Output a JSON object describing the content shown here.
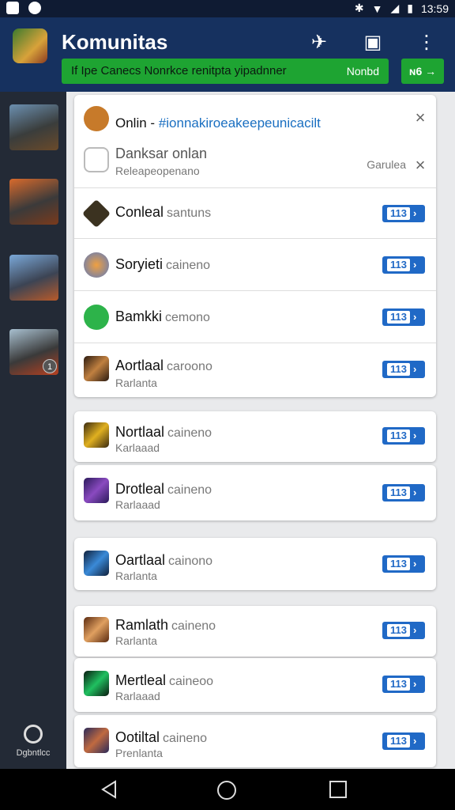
{
  "status_bar": {
    "time": "13:59"
  },
  "app_bar": {
    "title": "Komunitas",
    "banner_text": "If Ipe Canecs Nonrkce renitpta yipadnner",
    "banner_right": "Nonbd",
    "banner_button": "ɴ6 →",
    "actions": [
      "share-icon",
      "chat-icon",
      "more-icon"
    ]
  },
  "rail": {
    "games": [
      {
        "name": "game-1"
      },
      {
        "name": "game-2"
      },
      {
        "name": "game-3"
      },
      {
        "name": "game-4",
        "badge": "1"
      }
    ],
    "bottom_label": "Dgbntlcc"
  },
  "notifications": {
    "top": {
      "title": "Onlin -",
      "hashtag": "#ionnakiroeakeepeunicacilt",
      "close": "×"
    },
    "second": {
      "title": "Danksar onlan",
      "subtitle": "Releapeopenano",
      "side": "Garulea",
      "close": "×"
    }
  },
  "rows": [
    {
      "title": "Conleal",
      "tag": "santuns",
      "sub": "",
      "btn": "113"
    },
    {
      "title": "Soryieti",
      "tag": "caineno",
      "sub": "",
      "btn": "113"
    },
    {
      "title": "Bamkki",
      "tag": "cemono",
      "sub": "",
      "btn": "113"
    },
    {
      "title": "Aortlaal",
      "tag": "caroono",
      "sub": "Rarlanta",
      "btn": "113"
    },
    {
      "title": "Nortlaal",
      "tag": "caineno",
      "sub": "Karlaaad",
      "btn": "113"
    },
    {
      "title": "Drotleal",
      "tag": "caineno",
      "sub": "Rarlaaad",
      "btn": "113"
    },
    {
      "title": "Oartlaal",
      "tag": "cainono",
      "sub": "Rarlanta",
      "btn": "113"
    },
    {
      "title": "Ramlath",
      "tag": "caineno",
      "sub": "Rarlanta",
      "btn": "113"
    },
    {
      "title": "Mertleal",
      "tag": "caineoo",
      "sub": "Rarlaaad",
      "btn": "113"
    },
    {
      "title": "Ootiltal",
      "tag": "caineno",
      "sub": "Prenlanta",
      "btn": "113"
    }
  ],
  "colors": {
    "appbar": "#16315f",
    "banner": "#1ea432",
    "button": "#2069c6"
  }
}
